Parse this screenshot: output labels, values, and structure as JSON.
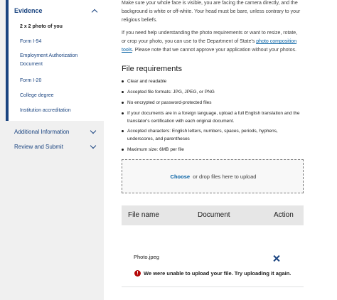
{
  "sidebar": {
    "evidence": {
      "label": "Evidence"
    },
    "sub_items": [
      {
        "label": "2 x 2 photo of you"
      },
      {
        "label": "Form I-94"
      },
      {
        "label": "Employment Authorization Document"
      },
      {
        "label": "Form I-20"
      },
      {
        "label": "College degree"
      },
      {
        "label": "Institution accreditation"
      }
    ],
    "additional": {
      "label": "Additional Information"
    },
    "review": {
      "label": "Review and Submit"
    }
  },
  "main": {
    "intro_text": "Make sure your whole face is visible, you are facing the camera directly, and the background is white or off-white. Your head must be bare, unless contrary to your religious beliefs.",
    "help_prefix": "If you need help understanding the photo requirements or want to resize, rotate, or crop your photo, you can use to the Department of State's ",
    "help_link": "photo composition tools",
    "help_suffix": ". Please note that we cannot approve your application without your photos.",
    "file_requirements_heading": "File requirements",
    "requirements": [
      "Clear and readable",
      "Accepted file formats: JPG, JPEG, or PNG",
      "No encrypted or password-protected files",
      "If your documents are in a foreign language, upload a full English translation and the translator's certification with each original document.",
      "Accepted characters: English letters, numbers, spaces, periods, hyphens, underscores, and parentheses",
      "Maximum size: 6MB per file"
    ],
    "upload": {
      "choose_label": "Choose",
      "rest_label": "or drop files here to upload"
    },
    "table": {
      "headers": [
        "File name",
        "Document",
        "Action"
      ],
      "file_name": "Photo.jpeg",
      "error_message": "We were unable to upload your file. Try uploading it again."
    }
  },
  "colors": {
    "primary": "#1a4480",
    "link": "#005ea2",
    "error": "#b50909",
    "sidebar_bg": "#f0f0f0"
  },
  "icons": [
    "chevron-up-icon",
    "chevron-down-icon",
    "close-icon",
    "error-icon"
  ]
}
